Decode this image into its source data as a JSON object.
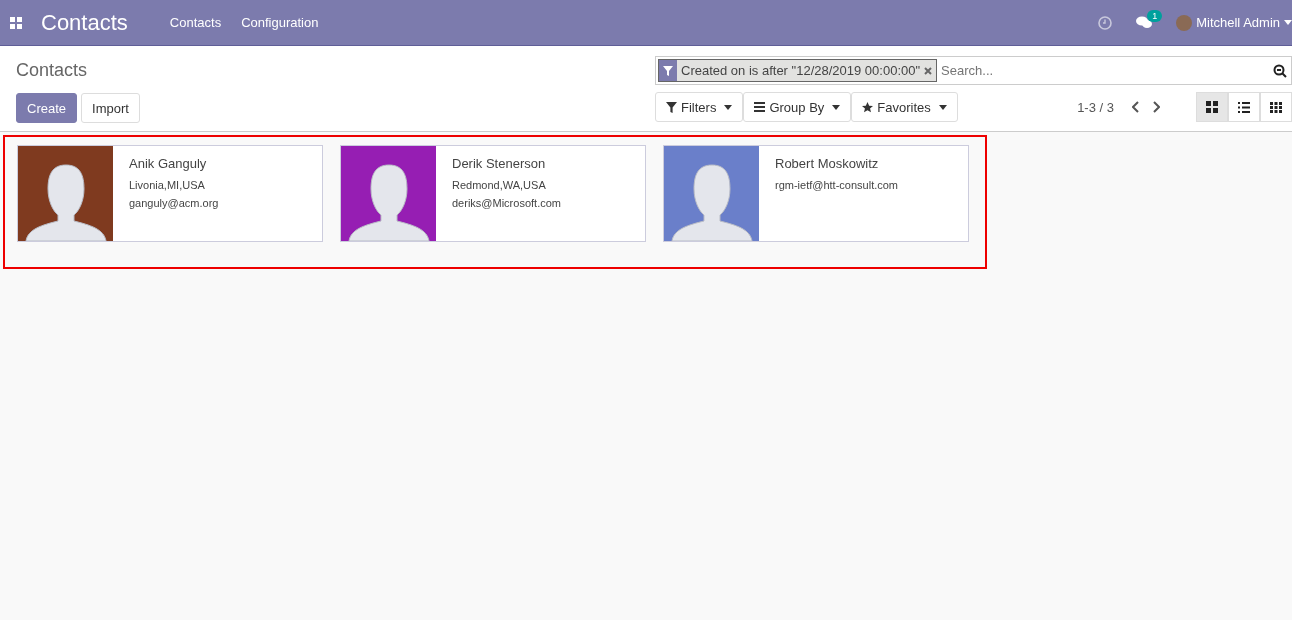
{
  "navbar": {
    "app_title": "Contacts",
    "menu": [
      "Contacts",
      "Configuration"
    ],
    "messages_badge": "1",
    "user": "Mitchell Admin"
  },
  "breadcrumb": "Contacts",
  "buttons": [
    "Create",
    "Import"
  ],
  "search": {
    "facet": "Created on is after \"12/28/2019 00:00:00\"",
    "placeholder": "Search..."
  },
  "search_menus": [
    {
      "kind": "filter",
      "label": "Filters"
    },
    {
      "kind": "group",
      "label": "Group By"
    },
    {
      "kind": "favorite",
      "label": "Favorites"
    }
  ],
  "pager": "1-3 / 3",
  "views": [
    {
      "kind": "kanban",
      "selected": true
    },
    {
      "kind": "list",
      "selected": false
    },
    {
      "kind": "grid",
      "selected": false
    }
  ],
  "cards": [
    {
      "name": "Anik Ganguly",
      "color": "#7f3a1f",
      "lines": [
        "Livonia,MI,USA",
        "ganguly@acm.org"
      ]
    },
    {
      "name": "Derik Stenerson",
      "color": "#961eb3",
      "lines": [
        "Redmond,WA,USA",
        "deriks@Microsoft.com"
      ]
    },
    {
      "name": "Robert Moskowitz",
      "color": "#6a7fca",
      "lines": [
        "rgm-ietf@htt-consult.com"
      ]
    }
  ]
}
